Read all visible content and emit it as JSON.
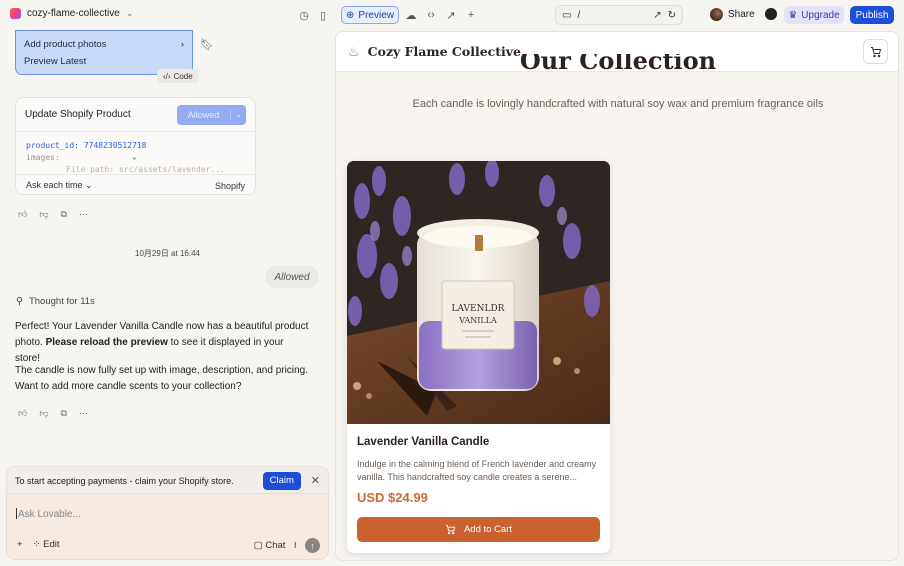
{
  "topbar": {
    "project_name": "cozy-flame-collective",
    "preview_label": "Preview",
    "url_path": "/",
    "share_label": "Share",
    "upgrade_label": "Upgrade",
    "publish_label": "Publish"
  },
  "chat": {
    "task_card": {
      "line1": "Add product photos",
      "line2": "Preview Latest",
      "code_chip": "Code"
    },
    "tool_card": {
      "title": "Update Shopify Product",
      "allowed_button": "Allowed",
      "code_key1": "product_id:",
      "code_val1": "7748230512718",
      "code_key2": "images:",
      "code_line3": "File path: src/assets/lavender...",
      "permission": "Ask each time",
      "provider": "Shopify"
    },
    "timestamp": "10月29日 at 16:44",
    "user_bubble": "Allowed",
    "thought": "Thought for 11s",
    "msg1_part1": "Perfect! Your Lavender Vanilla Candle now has a beautiful product photo. ",
    "msg1_bold": "Please reload the preview",
    "msg1_part2": " to see it displayed in your store!",
    "msg2": "The candle is now fully set up with image, description, and pricing. Want to add more candle scents to your collection?",
    "payment_notice": "To start accepting payments - claim your Shopify store.",
    "claim_label": "Claim",
    "input_placeholder": "Ask Lovable...",
    "edit_label": "Edit",
    "chat_label": "Chat"
  },
  "store": {
    "brand": "Cozy Flame Collective",
    "collection_title": "Our Collection",
    "subtitle": "Each candle is lovingly handcrafted with natural soy wax and premium fragrance oils",
    "product": {
      "name": "Lavender Vanilla Candle",
      "description": "Indulge in the calming blend of French lavender and creamy vanilla. This handcrafted soy candle creates a serene...",
      "price": "USD $24.99",
      "add_to_cart": "Add to Cart",
      "label_line1": "LAVENLDR",
      "label_line2": "VANILLA"
    }
  }
}
